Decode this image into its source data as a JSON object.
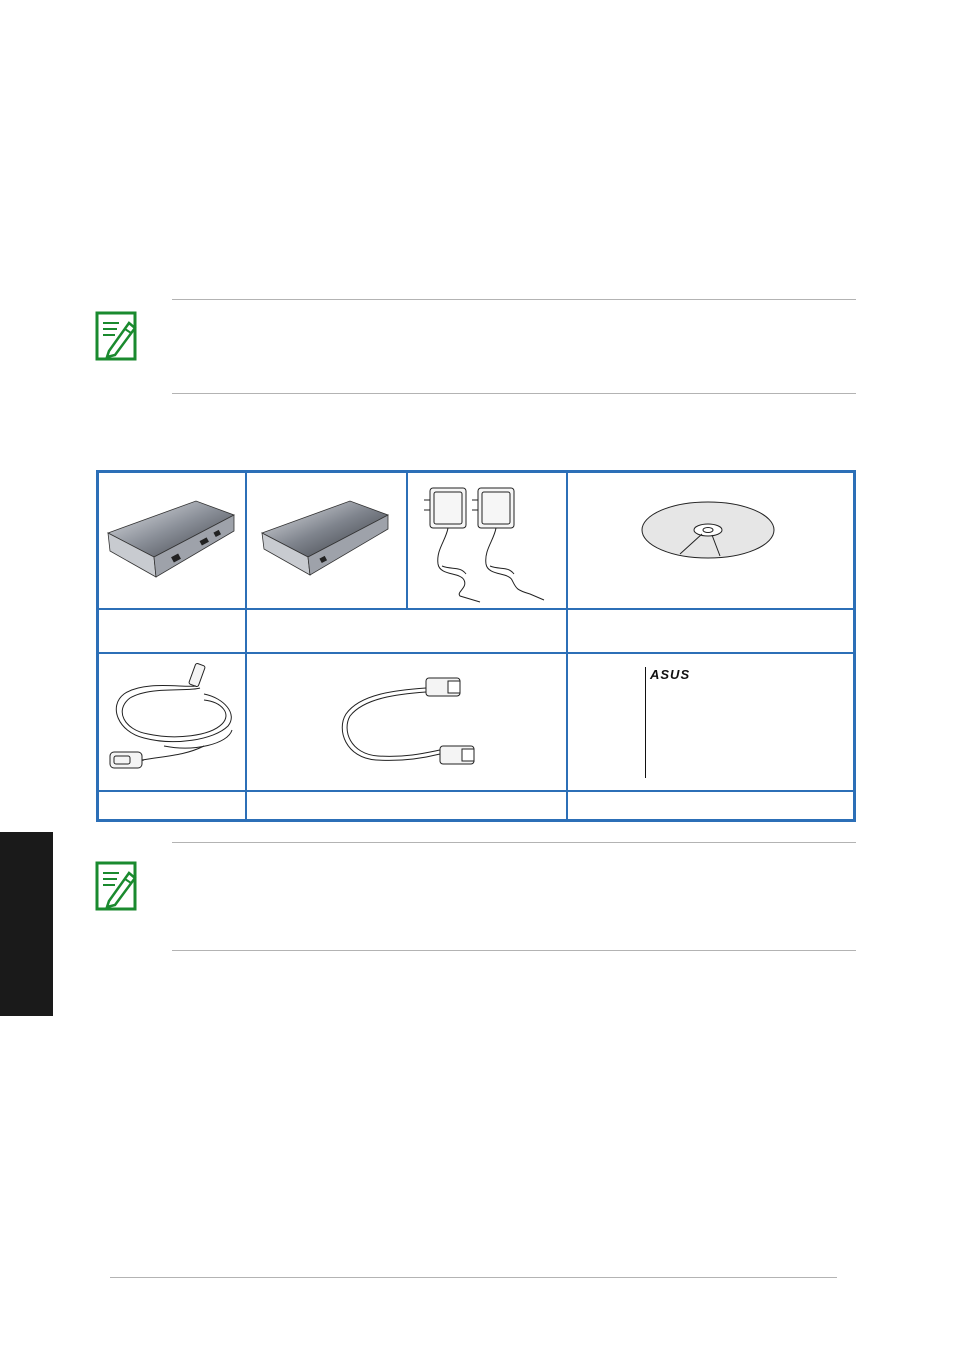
{
  "notes": [
    {
      "icon": "note-pencil-icon",
      "text": ""
    },
    {
      "icon": "note-pencil-icon",
      "text": ""
    }
  ],
  "package_table": {
    "row1_labels": [
      "",
      "",
      "",
      ""
    ],
    "row2_labels": [
      "",
      "",
      ""
    ],
    "brand_logo": "ASUS",
    "colors": {
      "border": "#2c6fb7",
      "note_icon": "#1a8a2e"
    }
  },
  "footer": {
    "page_number": ""
  }
}
